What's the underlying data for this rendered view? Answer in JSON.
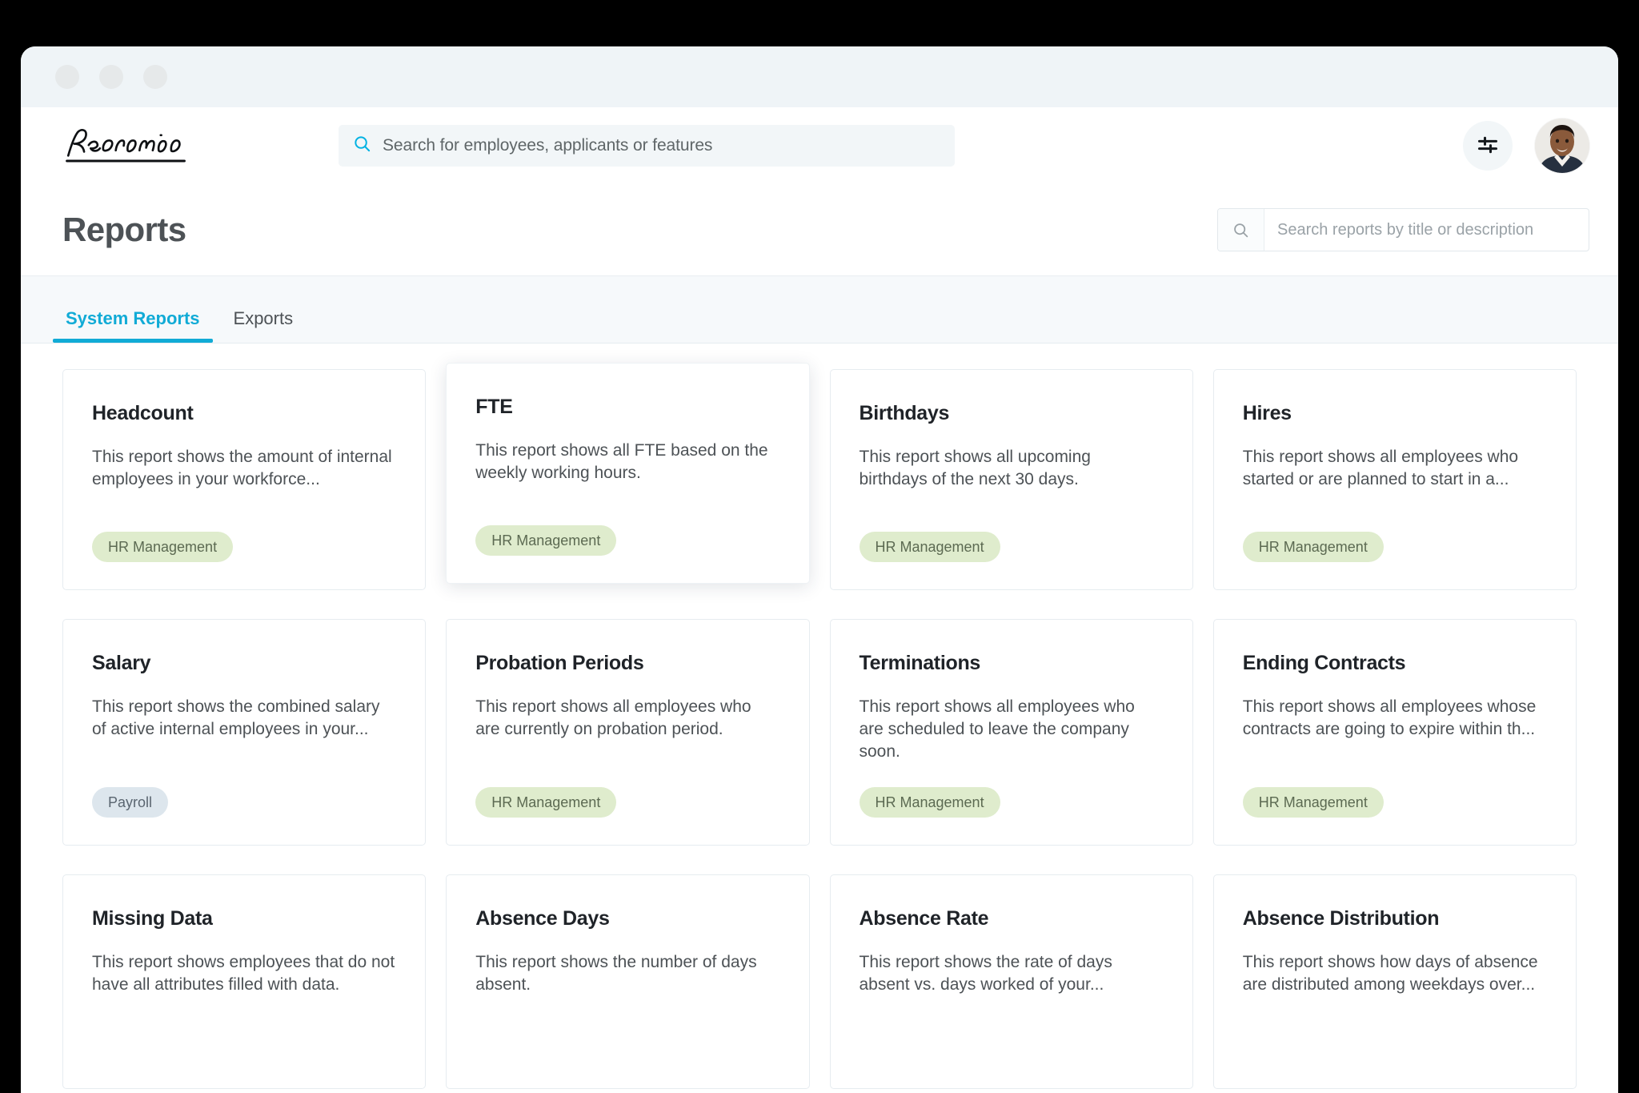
{
  "window": {
    "chrome_dots": [
      "dot-close",
      "dot-minimize",
      "dot-maximize"
    ]
  },
  "appbar": {
    "logo_text": "Personio",
    "search": {
      "placeholder": "Search for employees, applicants or features",
      "value": ""
    },
    "settings_icon": "sliders-icon",
    "avatar_icon": "user-avatar"
  },
  "page_header": {
    "title": "Reports",
    "search": {
      "placeholder": "Search reports by title or description",
      "value": "",
      "icon": "search-icon"
    }
  },
  "tabs": [
    {
      "label": "System Reports",
      "active": true
    },
    {
      "label": "Exports",
      "active": false
    }
  ],
  "colors": {
    "accent": "#11abd6",
    "badge_hr_bg": "#dfeccd",
    "badge_hr_text": "#5c6a52",
    "badge_payroll_bg": "#dde6ed",
    "badge_payroll_text": "#5a6570",
    "card_border": "#e6ecf0",
    "page_bg": "#ffffff",
    "tabstrip_bg": "#f6f9fb"
  },
  "cards": [
    {
      "title": "Headcount",
      "description": "This report shows the amount of internal employees in your workforce...",
      "badge": "HR Management",
      "badge_type": "hr",
      "elevated": false
    },
    {
      "title": "FTE",
      "description": "This report shows all FTE based on the weekly working hours.",
      "badge": "HR Management",
      "badge_type": "hr",
      "elevated": true
    },
    {
      "title": "Birthdays",
      "description": "This report shows all upcoming birthdays of the next 30 days.",
      "badge": "HR Management",
      "badge_type": "hr",
      "elevated": false
    },
    {
      "title": "Hires",
      "description": "This report shows all employees who started or are planned to start in a...",
      "badge": "HR Management",
      "badge_type": "hr",
      "elevated": false
    },
    {
      "title": "Salary",
      "description": "This report shows the combined salary of active internal employees in your...",
      "badge": "Payroll",
      "badge_type": "payroll",
      "elevated": false
    },
    {
      "title": "Probation Periods",
      "description": "This report shows all employees who are currently on probation period.",
      "badge": "HR Management",
      "badge_type": "hr",
      "elevated": false
    },
    {
      "title": "Terminations",
      "description": "This report shows all employees who are scheduled to leave the company soon.",
      "badge": "HR Management",
      "badge_type": "hr",
      "elevated": false
    },
    {
      "title": "Ending Contracts",
      "description": "This report shows all employees whose contracts are going to expire within th...",
      "badge": "HR Management",
      "badge_type": "hr",
      "elevated": false
    },
    {
      "title": "Missing Data",
      "description": "This report shows employees that do not have all attributes filled with data.",
      "badge": "",
      "badge_type": "none",
      "elevated": false
    },
    {
      "title": "Absence Days",
      "description": "This report shows the number of days absent.",
      "badge": "",
      "badge_type": "none",
      "elevated": false
    },
    {
      "title": "Absence Rate",
      "description": "This report shows the rate of days absent vs. days worked of your...",
      "badge": "",
      "badge_type": "none",
      "elevated": false
    },
    {
      "title": "Absence Distribution",
      "description": "This report shows how days of absence are distributed among weekdays over...",
      "badge": "",
      "badge_type": "none",
      "elevated": false
    }
  ]
}
